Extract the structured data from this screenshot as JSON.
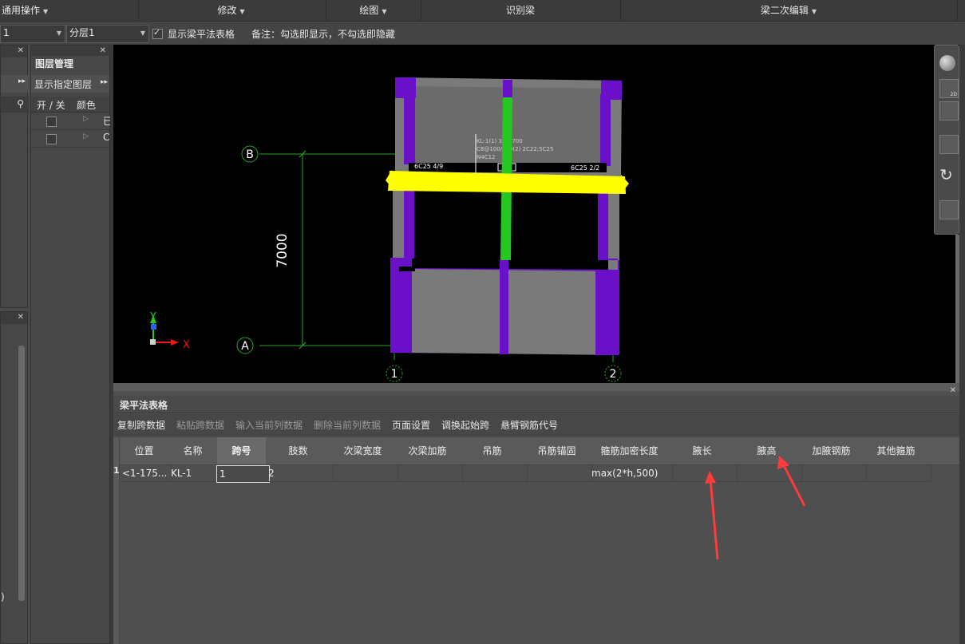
{
  "ribbon": {
    "general": "通用操作",
    "modify": "修改",
    "draw": "绘图",
    "recognize": "识别梁",
    "secondary_edit": "梁二次编辑"
  },
  "toolbar": {
    "floor_value": "1",
    "layer_value": "分层1",
    "show_table_label": "显示梁平法表格",
    "note": "备注：勾选即显示，不勾选即隐藏"
  },
  "layer_panel": {
    "title": "图层管理",
    "show_layer": "显示指定图层",
    "col_toggle": "开 / 关",
    "col_color": "颜色",
    "rows": [
      "已",
      "C"
    ]
  },
  "left_panel": {
    "stray_text": ")"
  },
  "viewport": {
    "axis_b": "B",
    "axis_a": "A",
    "axis_1": "1",
    "axis_2": "2",
    "dimension": "7000",
    "ucs_y": "Y",
    "ucs_x": "X",
    "left_rebar_label": "6C25 4/9",
    "right_rebar_label": "6C25 2/2",
    "beam_annotation": [
      "KL-1(1) 350*700",
      "C8@100/200(2) 2C22;5C25",
      "N4C12"
    ]
  },
  "table_panel": {
    "title": "梁平法表格",
    "toolbar": [
      "复制跨数据",
      "粘贴跨数据",
      "输入当前列数据",
      "删除当前列数据",
      "页面设置",
      "调换起始跨",
      "悬臂钢筋代号"
    ],
    "toolbar_enabled": [
      true,
      false,
      false,
      false,
      true,
      true,
      true
    ],
    "headers": [
      "位置",
      "名称",
      "跨号",
      "肢数",
      "次梁宽度",
      "次梁加筋",
      "吊筋",
      "吊筋锚固",
      "箍筋加密长度",
      "腋长",
      "腋高",
      "加腋钢筋",
      "其他箍筋"
    ],
    "row_index": "1",
    "row": [
      "<1-175...",
      "KL-1",
      "1",
      "2",
      "",
      "",
      "",
      "",
      "max(2*h,500)",
      "",
      "",
      "",
      ""
    ]
  },
  "colors": {
    "beam_gray": "#7a7a7a",
    "column_purple": "#6a10c8",
    "selected_beam": "#ffff00",
    "rebar_green": "#25c820",
    "axis_green": "#2aa52a",
    "arrow_red": "#ff3b3b"
  }
}
